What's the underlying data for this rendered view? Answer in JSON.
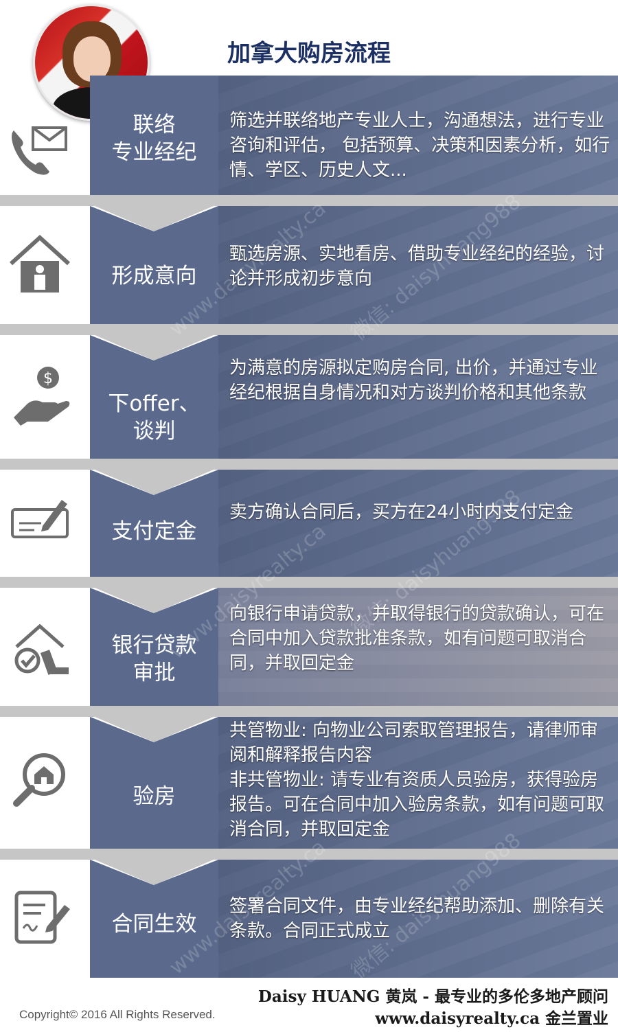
{
  "title": "加拿大购房流程",
  "colors": {
    "band": "#5b6a8c",
    "divider": "#c6c6c6",
    "title": "#1c2f63",
    "icon": "#6d6d6d"
  },
  "watermarks": [
    "www.daisyrealty.ca",
    "微信: daisyhuang988"
  ],
  "steps": [
    {
      "icon": "phone-envelope-icon",
      "label_lines": [
        "联络",
        "专业经纪"
      ],
      "desc": [
        "筛选并联络地产专业人士，沟通想法，进行专业咨询和评估， 包括预算、决策和因素分析，如行情、学区、历史人文..."
      ]
    },
    {
      "icon": "house-person-icon",
      "label_lines": [
        "形成意向"
      ],
      "desc": [
        "甄选房源、实地看房、借助专业经纪的经验，讨论并形成初步意向"
      ]
    },
    {
      "icon": "hand-money-icon",
      "label_lines": [
        "下offer、",
        "谈判"
      ],
      "desc": [
        "为满意的房源拟定购房合同, 出价，并通过专业经纪根据自身情况和对方谈判价格和其他条款"
      ]
    },
    {
      "icon": "check-pen-icon",
      "label_lines": [
        "支付定金"
      ],
      "desc": [
        "卖方确认合同后，买方在24小时内支付定金"
      ]
    },
    {
      "icon": "house-approved-icon",
      "label_lines": [
        "银行贷款",
        "审批"
      ],
      "desc": [
        "向银行申请贷款，并取得银行的贷款确认，可在合同中加入贷款批准条款，如有问题可取消合同，并取回定金"
      ]
    },
    {
      "icon": "magnifier-house-icon",
      "label_lines": [
        "验房"
      ],
      "desc": [
        "共管物业: 向物业公司索取管理报告，请律师审阅和解释报告内容",
        "非共管物业: 请专业有资质人员验房，获得验房报告。可在合同中加入验房条款，如有问题可取消合同，并取回定金"
      ]
    },
    {
      "icon": "contract-sign-icon",
      "label_lines": [
        "合同生效"
      ],
      "desc": [
        "签署合同文件，由专业经纪帮助添加、删除有关条款。合同正式成立"
      ]
    }
  ],
  "footer": {
    "line1": "Daisy HUANG 黄岚  -   最专业的多伦多地产顾问",
    "line2": "www.daisyrealty.ca  金兰置业",
    "copyright": "Copyright© 2016 All Rights Reserved."
  }
}
